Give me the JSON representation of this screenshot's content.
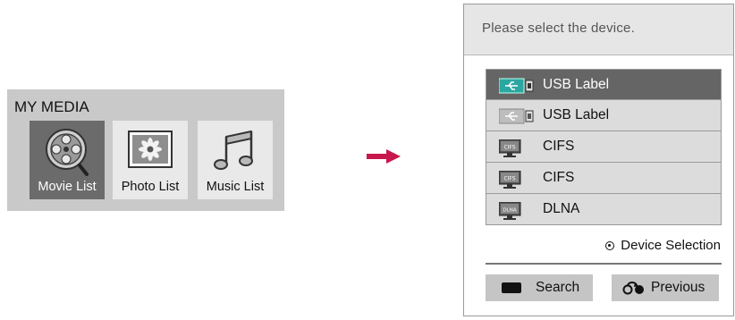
{
  "my_media": {
    "title": "MY MEDIA",
    "tiles": [
      {
        "label": "Movie List",
        "icon": "film-reel-icon",
        "selected": true
      },
      {
        "label": "Photo List",
        "icon": "photo-frame-icon",
        "selected": false
      },
      {
        "label": "Music List",
        "icon": "music-note-icon",
        "selected": false
      }
    ]
  },
  "arrow_icon": "right-arrow-icon",
  "colors": {
    "arrow": "#c8174c",
    "usb_accent": "#2aa7a0",
    "selected_bg": "#656565"
  },
  "dialog": {
    "title": "Please select the device.",
    "devices": [
      {
        "label": "USB Label",
        "icon": "usb-device-icon",
        "selected": true
      },
      {
        "label": "USB Label",
        "icon": "usb-device-icon",
        "selected": false
      },
      {
        "label": "CIFS",
        "icon": "cifs-monitor-icon",
        "icon_text": "CIFS",
        "selected": false
      },
      {
        "label": "CIFS",
        "icon": "cifs-monitor-icon",
        "icon_text": "CIFS",
        "selected": false
      },
      {
        "label": "DLNA",
        "icon": "dlna-monitor-icon",
        "icon_text": "DLNA",
        "selected": false
      }
    ],
    "hint": "Device Selection",
    "buttons": {
      "search": "Search",
      "previous": "Previous"
    }
  }
}
